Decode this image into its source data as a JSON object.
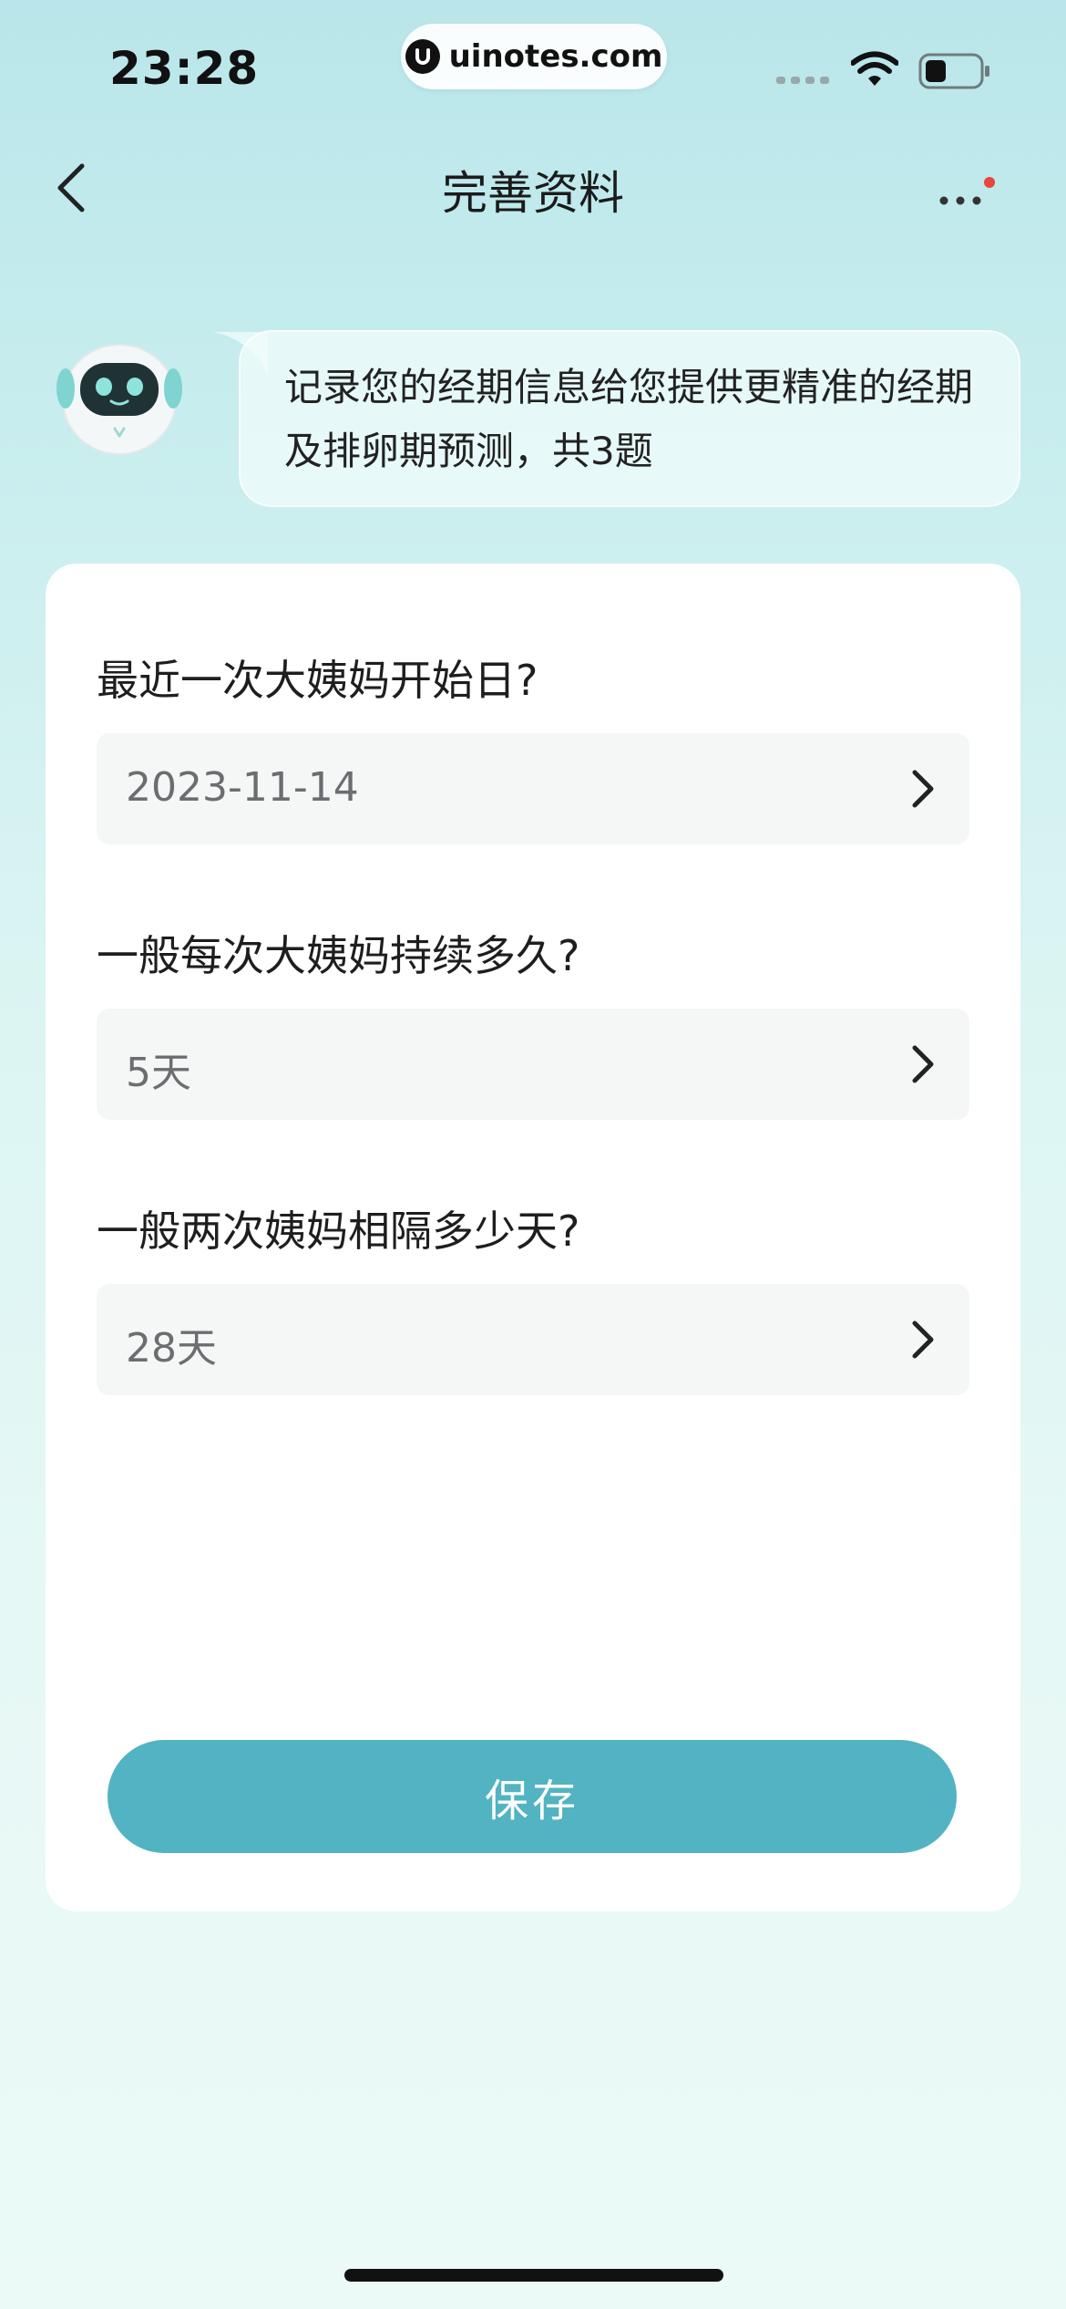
{
  "status_bar": {
    "time": "23:28",
    "url": "uinotes.com",
    "icons": [
      "signal-icon",
      "wifi-icon",
      "battery-icon"
    ]
  },
  "header": {
    "title": "完善资料",
    "back_icon": "chevron-left-icon",
    "more_icon": "more-dots-icon",
    "notification_dot_color": "#e8453c"
  },
  "bot": {
    "message": "记录您的经期信息给您提供更精准的经期及排卵期预测，共3题"
  },
  "form": {
    "questions": [
      {
        "label": "最近一次大姨妈开始日?",
        "value": "2023-11-14"
      },
      {
        "label": "一般每次大姨妈持续多久?",
        "value": "5天"
      },
      {
        "label": "一般两次姨妈相隔多少天?",
        "value": "28天"
      }
    ],
    "save_label": "保存"
  },
  "colors": {
    "accent": "#52b3c2",
    "field_bg": "#f5f7f7",
    "card_bg": "#ffffff"
  }
}
